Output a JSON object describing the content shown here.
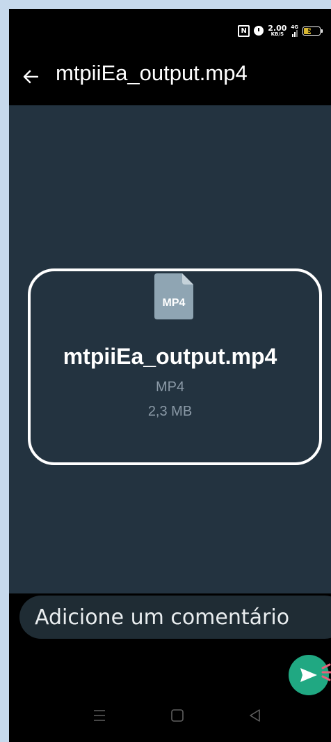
{
  "status_bar": {
    "speed_value": "2.00",
    "speed_unit": "KB/S",
    "network_type": "4G",
    "battery_level": "50",
    "icons": [
      "nfc-icon",
      "alarm-icon",
      "signal-icon",
      "battery-icon"
    ]
  },
  "header": {
    "back_icon": "arrow-left-icon",
    "title": "mtpiiEa_output.mp4"
  },
  "preview": {
    "icon_label": "MP4",
    "file_name": "mtpiiEa_output.mp4",
    "file_type": "MP4",
    "file_size": "2,3 MB"
  },
  "composer": {
    "placeholder": "Adicione um comentário",
    "send_icon": "send-icon"
  },
  "nav_bar": {
    "items": [
      "menu-icon",
      "home-icon",
      "back-triangle-icon"
    ]
  },
  "colors": {
    "background": "#233340",
    "accent": "#20a882",
    "card_border": "#ffffff",
    "secondary_text": "#8a99a6"
  }
}
